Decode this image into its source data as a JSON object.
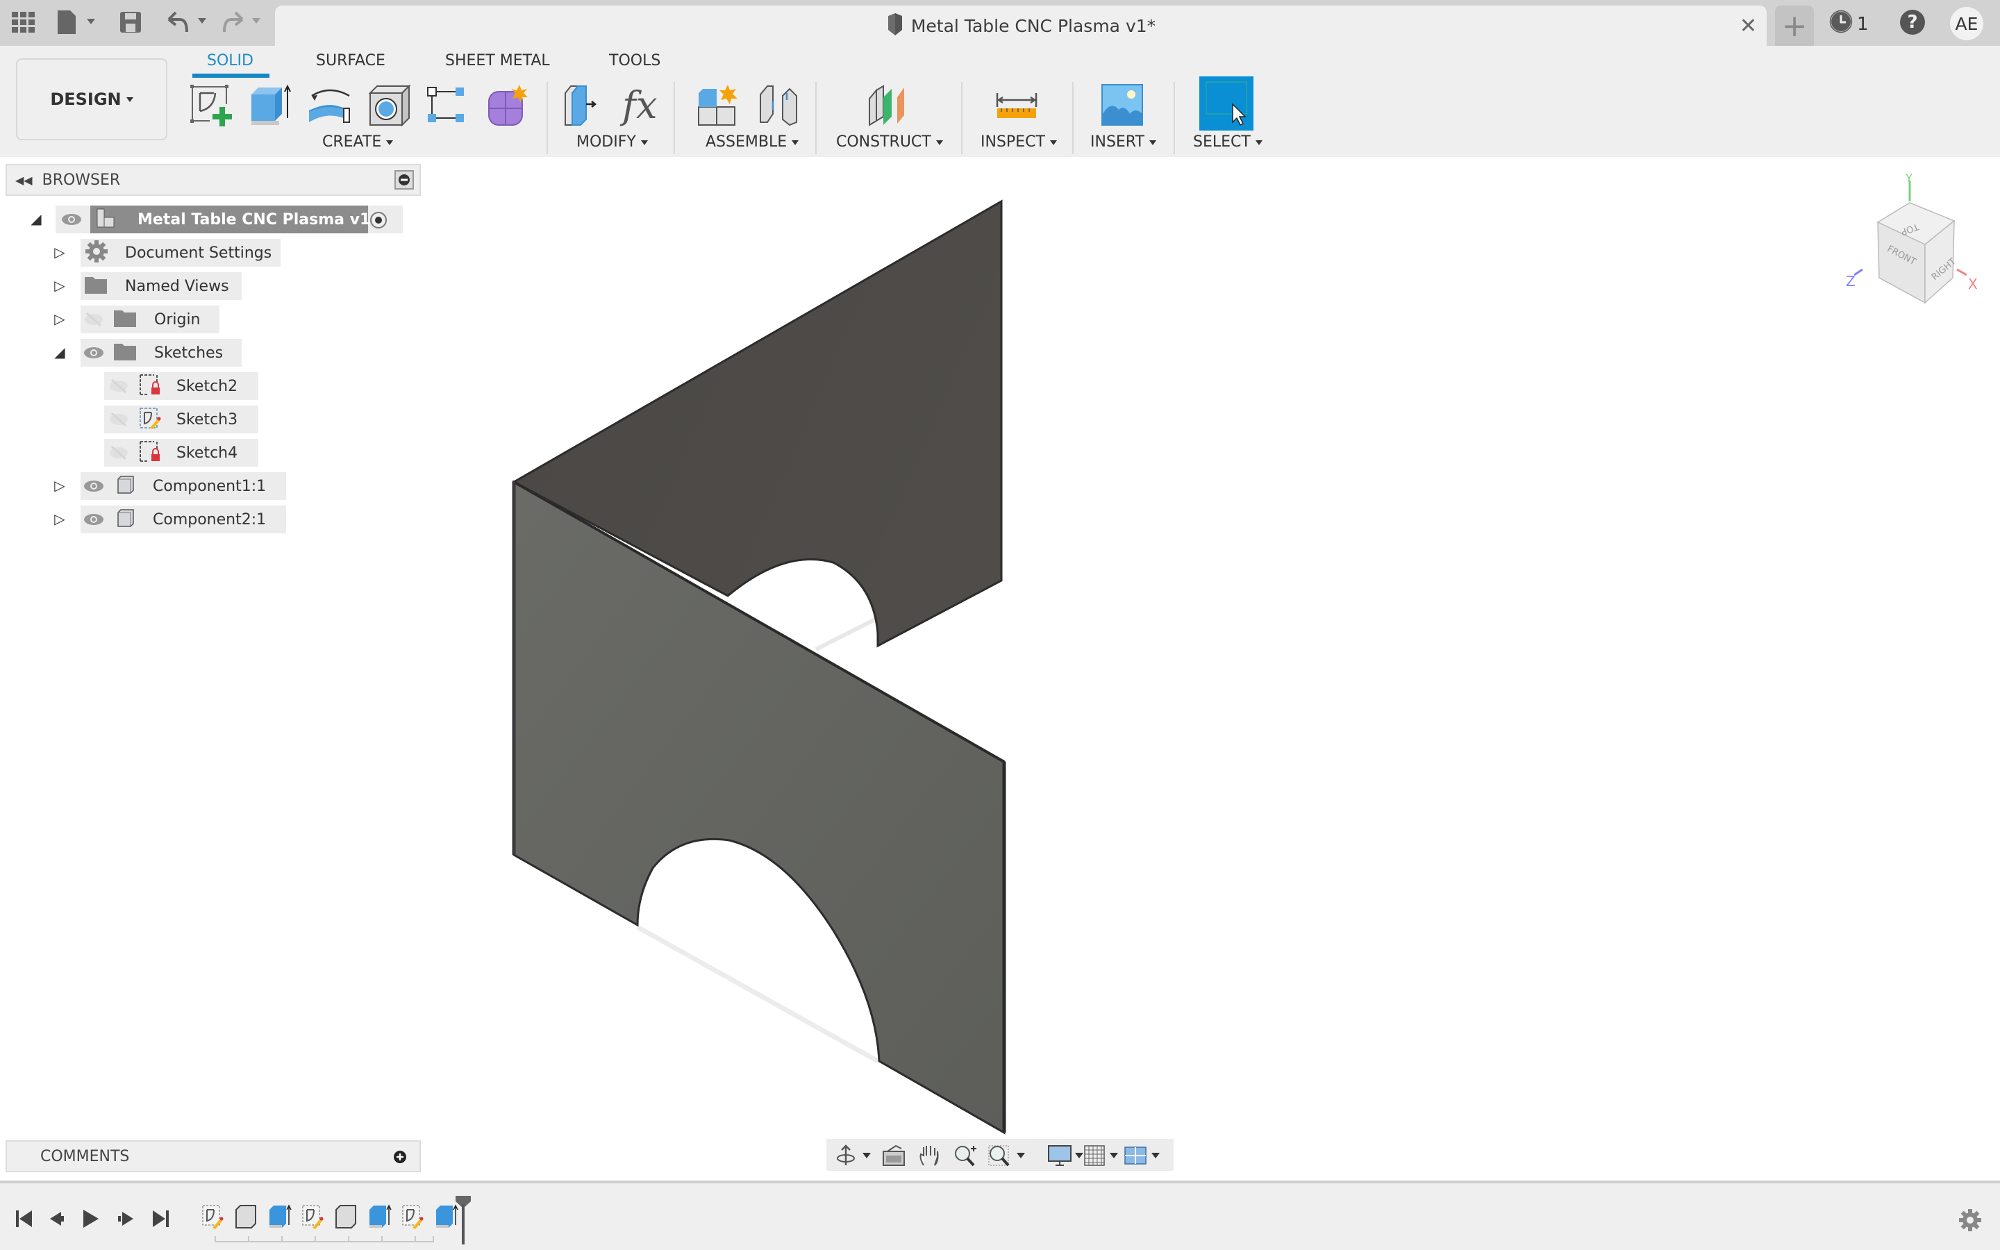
{
  "window": {
    "document_title": "Metal Table CNC Plasma v1*",
    "jobs_count": "1",
    "user_initials": "AE"
  },
  "workspace": {
    "label": "DESIGN"
  },
  "tabs": [
    {
      "label": "SOLID",
      "active": true
    },
    {
      "label": "SURFACE",
      "active": false
    },
    {
      "label": "SHEET METAL",
      "active": false
    },
    {
      "label": "TOOLS",
      "active": false
    }
  ],
  "toolbar_groups": {
    "create": "CREATE",
    "modify": "MODIFY",
    "assemble": "ASSEMBLE",
    "construct": "CONSTRUCT",
    "inspect": "INSPECT",
    "insert": "INSERT",
    "select": "SELECT"
  },
  "tools": {
    "create": [
      "create-sketch-icon",
      "extrude-icon",
      "revolve-icon",
      "hole-icon",
      "pattern-icon",
      "create-form-icon"
    ],
    "modify": [
      "press-pull-icon",
      "parameters-fx-icon"
    ],
    "assemble": [
      "new-component-icon",
      "joint-icon"
    ],
    "construct": [
      "offset-plane-icon"
    ],
    "inspect": [
      "measure-icon"
    ],
    "insert": [
      "insert-image-icon"
    ],
    "select": [
      "select-icon"
    ]
  },
  "browser": {
    "title": "BROWSER",
    "root": "Metal Table CNC Plasma v1",
    "items": [
      {
        "label": "Document Settings",
        "icon": "gear-icon",
        "expanded": false,
        "visible": null
      },
      {
        "label": "Named Views",
        "icon": "folder-icon",
        "expanded": false,
        "visible": null
      },
      {
        "label": "Origin",
        "icon": "folder-icon",
        "expanded": false,
        "visible": false
      },
      {
        "label": "Sketches",
        "icon": "folder-icon",
        "expanded": true,
        "visible": true
      },
      {
        "label": "Sketch2",
        "icon": "sketch-locked-icon",
        "visible": false
      },
      {
        "label": "Sketch3",
        "icon": "sketch-edit-icon",
        "visible": false
      },
      {
        "label": "Sketch4",
        "icon": "sketch-locked-icon",
        "visible": false
      },
      {
        "label": "Component1:1",
        "icon": "component-icon",
        "expanded": false,
        "visible": true
      },
      {
        "label": "Component2:1",
        "icon": "component-icon",
        "expanded": false,
        "visible": true
      }
    ]
  },
  "comments": {
    "title": "COMMENTS"
  },
  "viewcube": {
    "faces": [
      "TOP",
      "FRONT",
      "RIGHT"
    ],
    "axes": {
      "x": "X",
      "y": "Y",
      "z": "Z"
    }
  },
  "nav_tools": [
    "orbit-icon",
    "look-at-icon",
    "pan-hand-icon",
    "zoom-icon",
    "zoom-window-icon",
    "display-settings-icon",
    "grid-icon",
    "viewports-icon"
  ],
  "timeline": {
    "controls": [
      "go-to-start",
      "step-back",
      "play",
      "step-forward",
      "go-to-end"
    ],
    "features": [
      "sketch",
      "component",
      "extrude",
      "sketch",
      "component",
      "extrude",
      "sketch",
      "extrude"
    ]
  },
  "colors": {
    "accent": "#1587c4",
    "select_active": "#0a8fd4",
    "panel_dark": "#4e4b48",
    "panel_front": "#676864"
  }
}
